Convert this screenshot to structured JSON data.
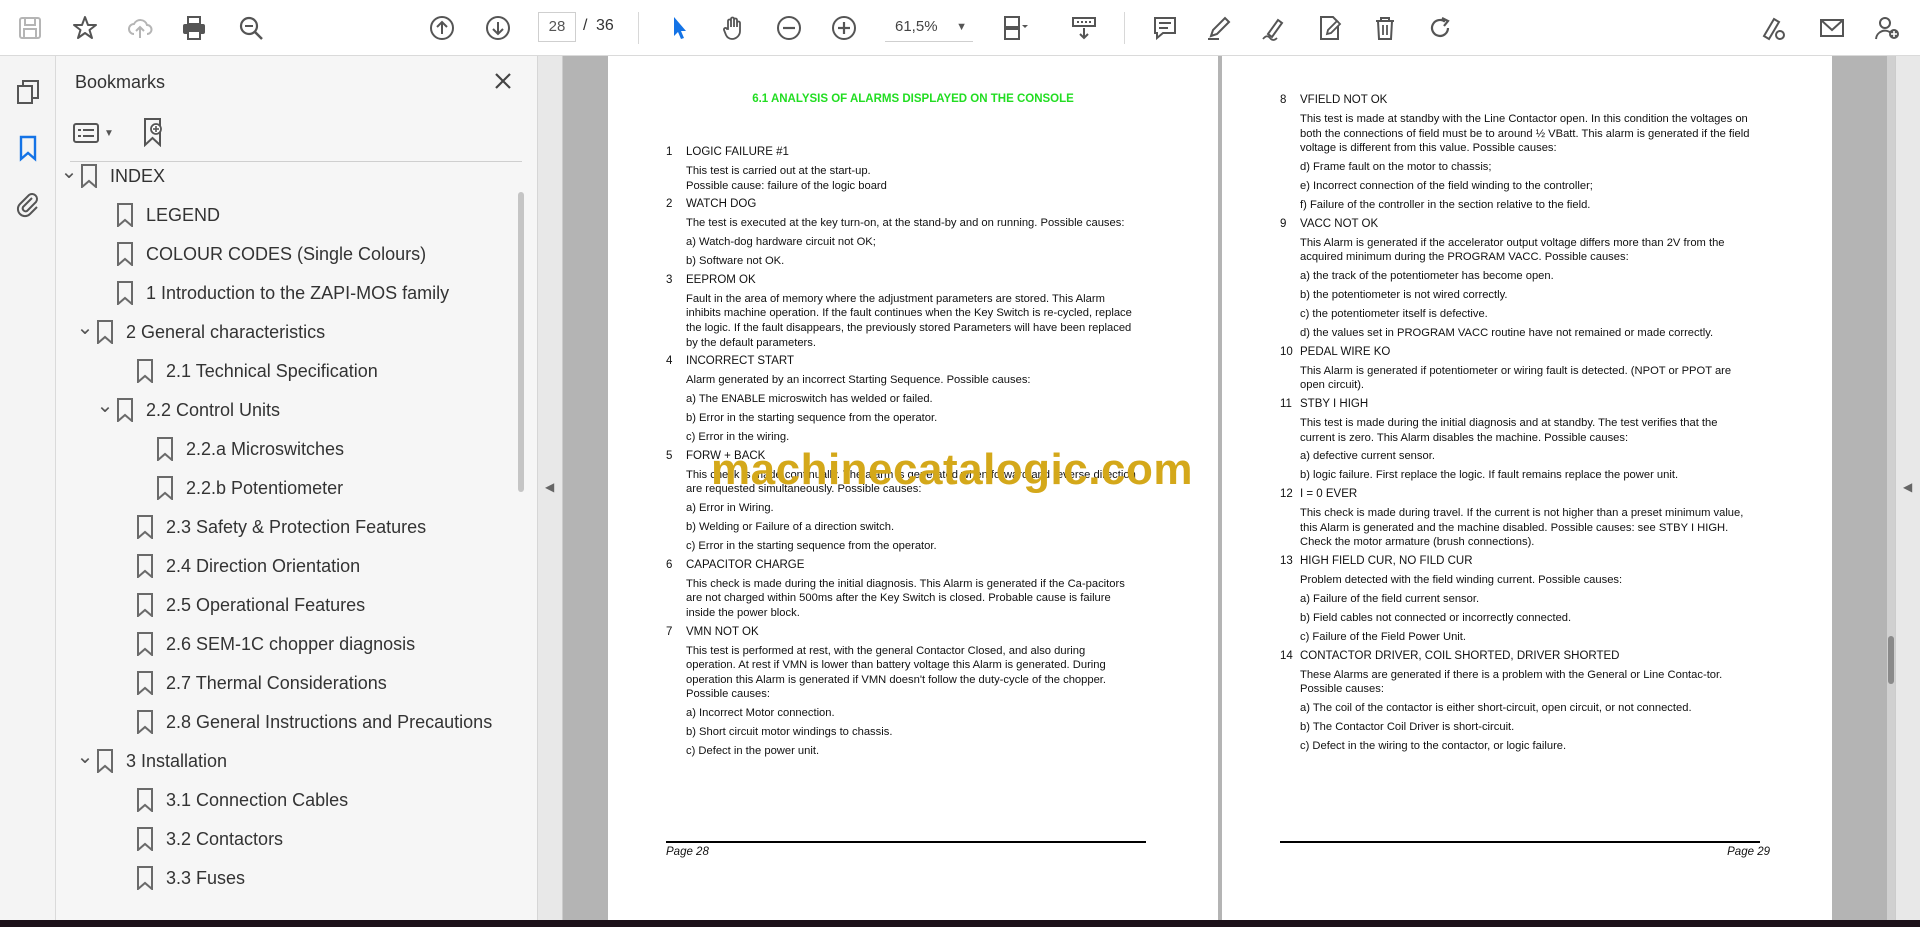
{
  "toolbar": {
    "page_current": "28",
    "page_separator": "/",
    "page_total": "36",
    "zoom": "61,5%",
    "icons": [
      "save-icon",
      "bookmark-star-icon",
      "cloud-upload-icon",
      "print-icon",
      "zoom-search-icon",
      "page-up-icon",
      "page-down-icon",
      "select-arrow-icon",
      "hand-tool-icon",
      "zoom-out-icon",
      "zoom-in-icon",
      "page-fit-icon",
      "scroll-mode-icon",
      "comment-icon",
      "highlight-pen-icon",
      "sign-icon",
      "edit-pdf-icon",
      "delete-icon",
      "rotate-icon",
      "share-link-icon",
      "email-icon",
      "account-icon"
    ]
  },
  "rail": {
    "icons": [
      "page-thumbnails-icon",
      "bookmarks-icon",
      "attachments-icon"
    ]
  },
  "bookmarks": {
    "title": "Bookmarks",
    "items": [
      {
        "label": "INDEX"
      },
      {
        "label": "LEGEND"
      },
      {
        "label": "COLOUR  CODES (Single Colours)"
      },
      {
        "label": "1  Introduction to the ZAPI-MOS family"
      },
      {
        "label": "2  General characteristics"
      },
      {
        "label": "2.1  Technical Specification"
      },
      {
        "label": "2.2  Control Units"
      },
      {
        "label": "2.2.a  Microswitches"
      },
      {
        "label": "2.2.b Potentiometer"
      },
      {
        "label": "2.3  Safety & Protection Features"
      },
      {
        "label": "2.4  Direction Orientation"
      },
      {
        "label": "2.5  Operational Features"
      },
      {
        "label": "2.6  SEM-1C chopper diagnosis"
      },
      {
        "label": "2.7  Thermal Considerations"
      },
      {
        "label": "2.8  General Instructions and Precautions"
      },
      {
        "label": "3  Installation"
      },
      {
        "label": "3.1  Connection Cables"
      },
      {
        "label": "3.2  Contactors"
      },
      {
        "label": "3.3  Fuses"
      }
    ]
  },
  "doc": {
    "watermark": "machinecatalogic.com",
    "page28": {
      "title": "6.1 ANALYSIS OF ALARMS DISPLAYED ON THE CONSOLE",
      "footer": "Page 28",
      "sections": [
        {
          "num": "1",
          "head": "LOGIC FAILURE #1",
          "lines": [
            "This test is carried out at the start-up.\nPossible cause: failure of the logic board"
          ]
        },
        {
          "num": "2",
          "head": "WATCH DOG",
          "lines": [
            "The test is executed at the key turn-on, at the stand-by and on running. Possible causes:",
            "a) Watch-dog hardware circuit not OK;",
            "b) Software not OK."
          ]
        },
        {
          "num": "3",
          "head": "EEPROM OK",
          "lines": [
            "Fault in the area of memory where the adjustment parameters are stored. This Alarm inhibits machine operation. If the fault continues when the Key Switch is re-cycled, replace the logic. If the fault disappears, the previously stored Parameters will have been replaced by the default parameters."
          ]
        },
        {
          "num": "4",
          "head": "INCORRECT START",
          "lines": [
            "Alarm generated by an incorrect Starting Sequence. Possible causes:",
            "a) The ENABLE microswitch has welded or failed.",
            "b) Error in the starting sequence from  the operator.",
            "c) Error in the wiring."
          ]
        },
        {
          "num": "5",
          "head": "FORW + BACK",
          "lines": [
            "This check is made continually. The alarm is generated when forward and reverse direction are requested simultaneously. Possible causes:",
            "a) Error in Wiring.",
            "b) Welding or Failure of a direction switch.",
            "c) Error in the starting sequence from the operator."
          ]
        },
        {
          "num": "6",
          "head": "CAPACITOR CHARGE",
          "lines": [
            "This check is made during the initial diagnosis. This Alarm is generated if the Ca-pacitors are not charged within  500ms after the Key Switch is closed. Probable cause is failure inside the power block."
          ]
        },
        {
          "num": "7",
          "head": "VMN NOT OK",
          "lines": [
            "This test is performed at rest, with the general Contactor Closed,  and also during operation. At rest if VMN is lower than  battery voltage this Alarm is generated. During operation this Alarm is generated if VMN doesn't follow the duty-cycle of the chopper. Possible causes:",
            "a) Incorrect Motor connection.",
            "b) Short circuit motor windings to chassis.",
            "c) Defect in the power unit."
          ]
        }
      ]
    },
    "page29": {
      "footer": "Page 29",
      "sections": [
        {
          "num": "8",
          "head": "VFIELD NOT OK",
          "lines": [
            "This test is made at standby with the Line Contactor open. In this condition the voltages on both the connections of field must be to around ½ VBatt. This alarm is generated if the field voltage is different from this value. Possible causes:",
            "d) Frame fault on the motor to chassis;",
            "e) Incorrect connection of the field winding to the controller;",
            "f)  Failure of the controller in the section relative to the field."
          ]
        },
        {
          "num": "9",
          "head": "VACC NOT OK",
          "lines": [
            "This Alarm is generated if the accelerator output voltage  differs more than 2V from the acquired minimum during the PROGRAM VACC.  Possible causes:",
            "a) the track of the potentiometer has become open.",
            "b) the potentiometer  is not wired correctly.",
            "c) the potentiometer itself is defective.",
            "d) the values set in PROGRAM VACC routine have not remained or made correctly."
          ]
        },
        {
          "num": "10",
          "head": "PEDAL WIRE KO",
          "lines": [
            "This Alarm is generated if potentiometer or wiring fault is detected. (NPOT or PPOT are open circuit)."
          ]
        },
        {
          "num": "11",
          "head": "STBY I HIGH",
          "lines": [
            "This test is made during the initial diagnosis and at standby. The test verifies that the current is zero. This Alarm disables the machine. Possible causes:",
            "a) defective current sensor.",
            "b) logic failure. First replace the logic. If fault remains replace the power unit."
          ]
        },
        {
          "num": "12",
          "head": "I = 0 EVER",
          "lines": [
            "This check is made during travel. If the current is not higher than a preset minimum value, this Alarm is generated and the machine disabled. Possible causes: see STBY I HIGH. Check the motor armature (brush connections)."
          ]
        },
        {
          "num": "13",
          "head": "HIGH FIELD CUR, NO FILD CUR",
          "lines": [
            "Problem detected with the field winding current.  Possible causes:",
            "a) Failure of the field current sensor.",
            "b) Field cables not connected or incorrectly connected.",
            "c) Failure of the Field Power Unit."
          ]
        },
        {
          "num": "14",
          "head": "CONTACTOR DRIVER, COIL SHORTED, DRIVER SHORTED",
          "lines": [
            "These Alarms are generated if there is a problem with the General or Line Contac-tor. Possible causes:",
            "a) The coil of the contactor is either short-circuit, open circuit, or not connected.",
            "b) The Contactor Coil Driver is  short-circuit.",
            "c) Defect in the wiring to the contactor, or logic failure."
          ]
        }
      ]
    }
  }
}
